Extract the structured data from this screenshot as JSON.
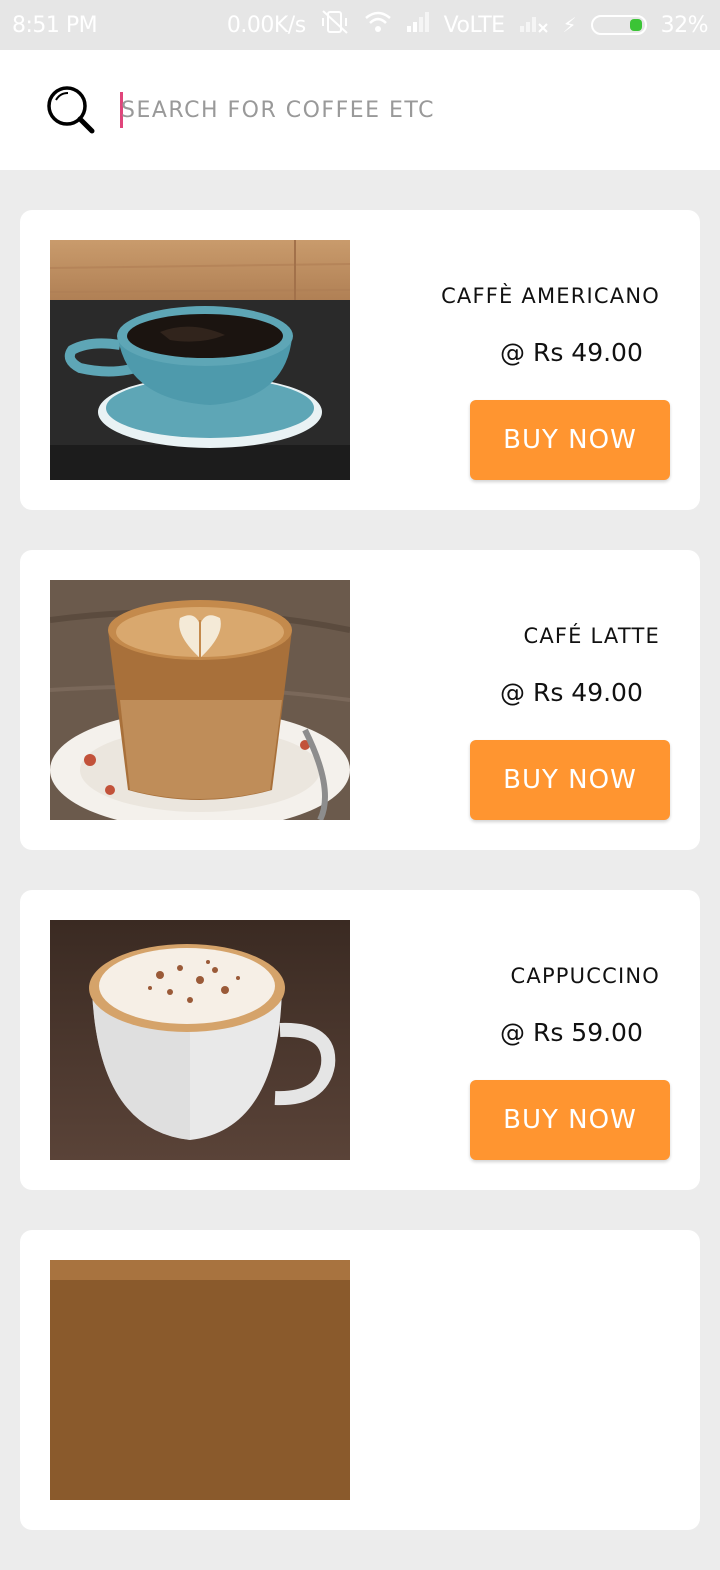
{
  "status_bar": {
    "time": "8:51 PM",
    "net_speed": "0.00K/s",
    "network": "VoLTE",
    "battery": "32%",
    "colors": {
      "battery_fill": "#3bc436"
    }
  },
  "search": {
    "placeholder": "SEARCH FOR COFFEE ETC",
    "value": ""
  },
  "theme": {
    "accent": "#ff9530",
    "caret": "#e0457b",
    "background": "#ececec"
  },
  "products": [
    {
      "name": "CAFFÈ AMERICANO",
      "price": "@ Rs 49.00",
      "button": "BUY NOW",
      "image": "americano-cup-photo"
    },
    {
      "name": "CAFÉ LATTE",
      "price": "@ Rs 49.00",
      "button": "BUY NOW",
      "image": "latte-glass-photo"
    },
    {
      "name": "CAPPUCCINO",
      "price": "@ Rs 59.00",
      "button": "BUY NOW",
      "image": "cappuccino-cup-photo"
    },
    {
      "image": "coffee-beans-photo"
    }
  ]
}
